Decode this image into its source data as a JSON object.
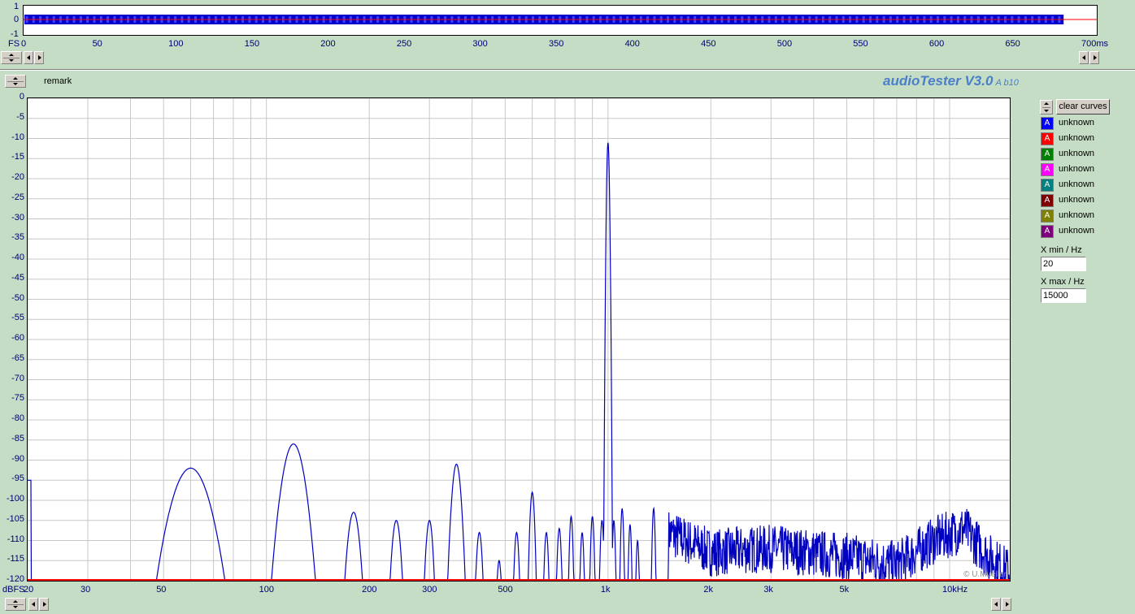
{
  "app": {
    "title": "audioTester V3.0",
    "version_suffix": "A b10",
    "remark_label": "remark",
    "copyright": "© U.Mueller"
  },
  "top_plot": {
    "y_labels": [
      "1",
      "0",
      "-1"
    ],
    "fs_label": "FS",
    "x_ticks": [
      "0",
      "50",
      "100",
      "150",
      "200",
      "250",
      "300",
      "350",
      "400",
      "450",
      "500",
      "550",
      "600",
      "650",
      "700ms"
    ],
    "x_range_ms": [
      0,
      700
    ],
    "signal_end_ms": 683
  },
  "spectrum": {
    "y_unit_label": "dBFS",
    "y_ticks": [
      "0",
      "-5",
      "-10",
      "-15",
      "-20",
      "-25",
      "-30",
      "-35",
      "-40",
      "-45",
      "-50",
      "-55",
      "-60",
      "-65",
      "-70",
      "-75",
      "-80",
      "-85",
      "-90",
      "-95",
      "-100",
      "-105",
      "-110",
      "-115",
      "-120"
    ],
    "x_ticks": [
      "20",
      "30",
      "50",
      "100",
      "200",
      "300",
      "500",
      "1k",
      "2k",
      "3k",
      "5k",
      "10kHz"
    ]
  },
  "legend": {
    "clear_button": "clear curves",
    "entries": [
      {
        "label": "unknown",
        "glyph": "A",
        "color": "#0000ff"
      },
      {
        "label": "unknown",
        "glyph": "A",
        "color": "#ff0000"
      },
      {
        "label": "unknown",
        "glyph": "A",
        "color": "#008000"
      },
      {
        "label": "unknown",
        "glyph": "A",
        "color": "#ff00ff"
      },
      {
        "label": "unknown",
        "glyph": "A",
        "color": "#008080"
      },
      {
        "label": "unknown",
        "glyph": "A",
        "color": "#800000"
      },
      {
        "label": "unknown",
        "glyph": "A",
        "color": "#808000"
      },
      {
        "label": "unknown",
        "glyph": "A",
        "color": "#800080"
      }
    ]
  },
  "controls": {
    "xmin_label": "X min / Hz",
    "xmin_value": "20",
    "xmax_label": "X max / Hz",
    "xmax_value": "15000"
  },
  "chart_data": {
    "type": "line",
    "xscale": "log",
    "xlim": [
      20,
      15000
    ],
    "ylim": [
      -120,
      0
    ],
    "xlabel": "",
    "ylabel": "dBFS",
    "grid": true,
    "series": [
      {
        "color": "#0000c0",
        "peaks": [
          {
            "x": 60,
            "y": -92,
            "w": 0.06
          },
          {
            "x": 120,
            "y": -86,
            "w": 0.035
          },
          {
            "x": 180,
            "y": -103,
            "w": 0.02
          },
          {
            "x": 240,
            "y": -105,
            "w": 0.015
          },
          {
            "x": 300,
            "y": -105,
            "w": 0.012
          },
          {
            "x": 360,
            "y": -91,
            "w": 0.015
          },
          {
            "x": 420,
            "y": -108,
            "w": 0.01
          },
          {
            "x": 480,
            "y": -115,
            "w": 0.008
          },
          {
            "x": 540,
            "y": -108,
            "w": 0.008
          },
          {
            "x": 600,
            "y": -98,
            "w": 0.008
          },
          {
            "x": 660,
            "y": -108,
            "w": 0.007
          },
          {
            "x": 720,
            "y": -107,
            "w": 0.007
          },
          {
            "x": 780,
            "y": -104,
            "w": 0.006
          },
          {
            "x": 840,
            "y": -108,
            "w": 0.006
          },
          {
            "x": 900,
            "y": -104,
            "w": 0.006
          },
          {
            "x": 960,
            "y": -105,
            "w": 0.006
          },
          {
            "x": 1000,
            "y": -11,
            "w": 0.004
          },
          {
            "x": 1040,
            "y": -105,
            "w": 0.005
          },
          {
            "x": 1100,
            "y": -102,
            "w": 0.005
          },
          {
            "x": 1160,
            "y": -106,
            "w": 0.005
          },
          {
            "x": 1220,
            "y": -110,
            "w": 0.005
          },
          {
            "x": 1360,
            "y": -102,
            "w": 0.005
          }
        ],
        "noise": [
          {
            "x": 1500,
            "y": -108
          },
          {
            "x": 2000,
            "y": -113
          },
          {
            "x": 3000,
            "y": -112
          },
          {
            "x": 5000,
            "y": -114
          },
          {
            "x": 7000,
            "y": -116
          },
          {
            "x": 9000,
            "y": -110
          },
          {
            "x": 11000,
            "y": -107
          },
          {
            "x": 13000,
            "y": -114
          },
          {
            "x": 15000,
            "y": -118
          }
        ]
      },
      {
        "color": "#ff0000",
        "points": [
          {
            "x": 20,
            "y": -120
          },
          {
            "x": 15000,
            "y": -120
          }
        ]
      }
    ]
  }
}
